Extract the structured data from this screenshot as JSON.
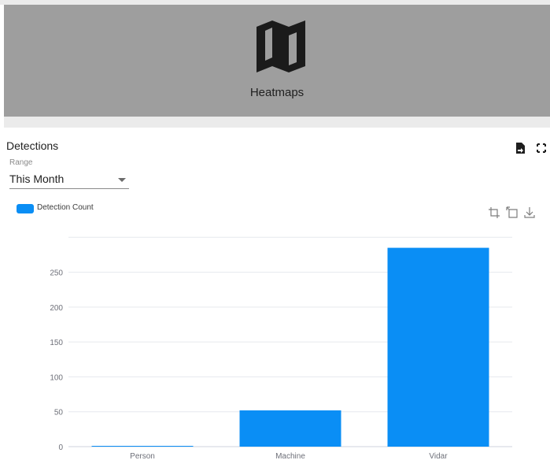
{
  "heatmaps_card": {
    "label": "Heatmaps",
    "icon": "map-icon"
  },
  "panel": {
    "title": "Detections",
    "export_icon": "file-export-icon",
    "fullscreen_icon": "fullscreen-icon"
  },
  "range": {
    "label": "Range",
    "value": "This Month"
  },
  "chart_toolbar": {
    "zoom_icon": "crop-zoom-icon",
    "zoom_reset_icon": "zoom-reset-icon",
    "download_icon": "download-icon"
  },
  "colors": {
    "bar": "#0a8ef5",
    "card": "#9e9e9e"
  },
  "chart_data": {
    "type": "bar",
    "legend": [
      "Detection Count"
    ],
    "categories": [
      "Person",
      "Machine",
      "Vidar"
    ],
    "series": [
      {
        "name": "Detection Count",
        "values": [
          1,
          52,
          285
        ]
      }
    ],
    "yticks": [
      0,
      50,
      100,
      150,
      200,
      250
    ],
    "ylim": [
      0,
      300
    ],
    "grid": true,
    "legend_position": "top-left"
  }
}
